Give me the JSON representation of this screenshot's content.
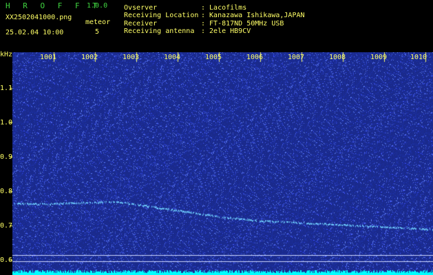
{
  "header": {
    "app_name": "H R O F F T",
    "version": "1.0.0",
    "filename": "XX2502041000.png",
    "datetime": "25.02.04 10:00",
    "meteor_label": "meteor",
    "meteor_count": "5",
    "info": [
      {
        "key": "Ovserver",
        "value": ": Lacofilms"
      },
      {
        "key": "Receiving Location",
        "value": ": Kanazawa Ishikawa,JAPAN"
      },
      {
        "key": "Receiver",
        "value": ": FT-817ND 50MHz USB"
      },
      {
        "key": "Receiving antenna",
        "value": ": 2ele HB9CV"
      }
    ]
  },
  "spectrogram": {
    "y_unit": "kHz",
    "y_ticks": [
      "1.1",
      "1.0",
      "0.9",
      "0.8",
      "0.7",
      "0.6"
    ],
    "x_ticks": [
      "1001",
      "1002",
      "1003",
      "1004",
      "1005",
      "1006",
      "1007",
      "1008",
      "1009",
      "1010"
    ],
    "trace_khz": [
      0.765,
      0.764,
      0.768,
      0.77,
      0.755,
      0.74,
      0.725,
      0.715,
      0.71,
      0.705,
      0.7,
      0.695,
      0.69
    ],
    "colors": {
      "background": "#1a2a8c",
      "trace": "#6fd0ff",
      "baseline": "#00ffff",
      "label": "#ffff66"
    }
  }
}
